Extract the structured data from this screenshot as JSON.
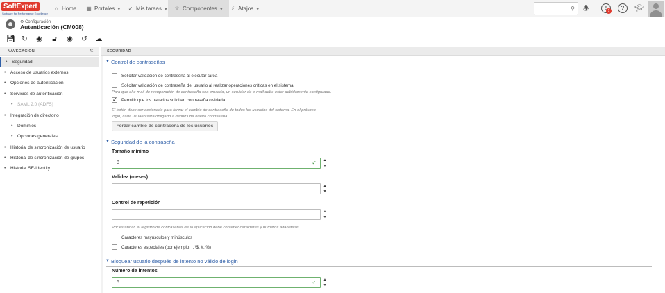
{
  "brand": {
    "name": "SoftExpert",
    "tagline": "Software for Performance Excellence"
  },
  "topnav": {
    "items": [
      {
        "label": "Home",
        "icon": "home-icon"
      },
      {
        "label": "Portales",
        "icon": "grid-icon"
      },
      {
        "label": "Mis tareas",
        "icon": "check-icon"
      },
      {
        "label": "Componentes",
        "icon": "trophy-icon"
      },
      {
        "label": "Atajos",
        "icon": "bolt-icon"
      }
    ],
    "notification_count": "1"
  },
  "page": {
    "breadcrumb": "Configuración",
    "title": "Autenticación (CM008)"
  },
  "toolbar": {
    "icons": [
      "save-icon",
      "sync-settings-icon",
      "view-icon",
      "lock-icon",
      "shield-icon",
      "refresh-icon",
      "cloud-sync-icon"
    ]
  },
  "sidebar": {
    "title": "NAVEGACIÓN",
    "items": [
      {
        "label": "Seguridad",
        "level": 0,
        "selected": true
      },
      {
        "label": "Acceso de usuarios externos",
        "level": 0
      },
      {
        "label": "Opciones de autenticación",
        "level": 0
      },
      {
        "label": "Servicios de autenticación",
        "level": 0
      },
      {
        "label": "SAML 2.0 (ADFS)",
        "level": 1,
        "disabled": true
      },
      {
        "label": "Integración de directorio",
        "level": 0
      },
      {
        "label": "Dominios",
        "level": 1
      },
      {
        "label": "Opciones generales",
        "level": 1
      },
      {
        "label": "Historial de sincronización de usuario",
        "level": 0
      },
      {
        "label": "Historial de sincronización de grupos",
        "level": 0
      },
      {
        "label": "Historial SE-Identity",
        "level": 0
      }
    ]
  },
  "main": {
    "header": "SEGURIDAD",
    "password_control": {
      "title": "Control de contraseñas",
      "opt1": "Solicitar validación de contraseña al ejecutar tarea",
      "opt2": "Solicitar validación de contraseña del usuario al realizar operaciones críticas en el sistema",
      "hint1": "Para que el e-mail de recuperación de contraseña sea enviado, un servidor de e-mail debe estar debidamente configurado.",
      "opt3": "Permitir que los usuarios soliciten contraseña olvidada",
      "opt3_checked": true,
      "hint2a": "El botón debe ser accionado para forzar el cambio de contraseña de todos los usuarios del sistema. En el próximo",
      "hint2b": "login, cada usuario será obligado a definir una nueva contraseña.",
      "force_button": "Forzar cambio de contraseña de los usuarios"
    },
    "password_security": {
      "title": "Seguridad de la contraseña",
      "min_size_label": "Tamaño mínimo",
      "min_size_value": "8",
      "validity_label": "Validez (meses)",
      "validity_value": "",
      "repetition_label": "Control de repetición",
      "repetition_value": "",
      "hint": "Por estándar, el registro de contraseñas de la aplicación debe contener caracteres y números alfabéticos",
      "case_label": "Caracteres mayúsculos y minúsculos",
      "special_label": "Caracteres especiales (por ejemplo, !, \\$, #, %)"
    },
    "lockout": {
      "title": "Bloquear usuario después de intento no válido de login",
      "attempts_label": "Número de intentos",
      "attempts_value": "5"
    }
  }
}
